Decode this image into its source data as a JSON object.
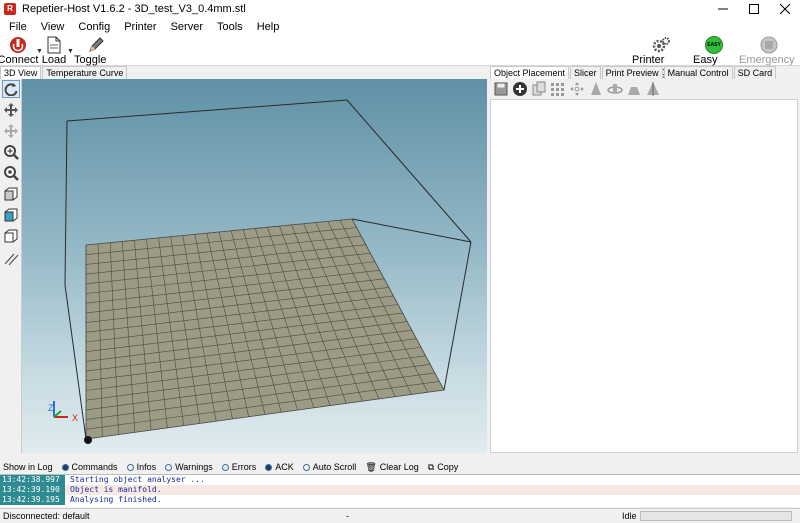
{
  "window": {
    "title": "Repetier-Host V1.6.2 - 3D_test_V3_0.4mm.stl",
    "icon_letter": "R"
  },
  "menu": [
    "File",
    "View",
    "Config",
    "Printer",
    "Server",
    "Tools",
    "Help"
  ],
  "toolbar": {
    "connect": "Connect",
    "load": "Load",
    "toggle_log": "Toggle Log",
    "printer_settings": "Printer Settings",
    "easy_mode": "Easy Mode",
    "easy_badge": "EASY",
    "emergency_stop": "Emergency Stop"
  },
  "left_tabs": [
    "3D View",
    "Temperature Curve"
  ],
  "right_tabs": [
    "Object Placement",
    "Slicer",
    "Print Preview",
    "Manual Control",
    "SD Card"
  ],
  "viewport": {
    "axis_x": "X",
    "axis_z": "Z"
  },
  "log_toolbar": {
    "show_in_log": "Show in Log",
    "commands": "Commands",
    "infos": "Infos",
    "warnings": "Warnings",
    "errors": "Errors",
    "ack": "ACK",
    "auto_scroll": "Auto Scroll",
    "clear_log": "Clear Log",
    "copy": "Copy"
  },
  "log": [
    {
      "time": "13:42:38.997",
      "msg": "Starting object analyser ..."
    },
    {
      "time": "13:42:39.190",
      "msg": "Object is manifold."
    },
    {
      "time": "13:42:39.195",
      "msg": "Analysing finished."
    }
  ],
  "status": {
    "connection": "Disconnected: default",
    "middle": "-",
    "state": "Idle"
  },
  "colors": {
    "accent": "#0078d7",
    "log_time_bg": "#2e8b91",
    "log_text": "#1a2aa0",
    "bed": "#9c9b86"
  }
}
